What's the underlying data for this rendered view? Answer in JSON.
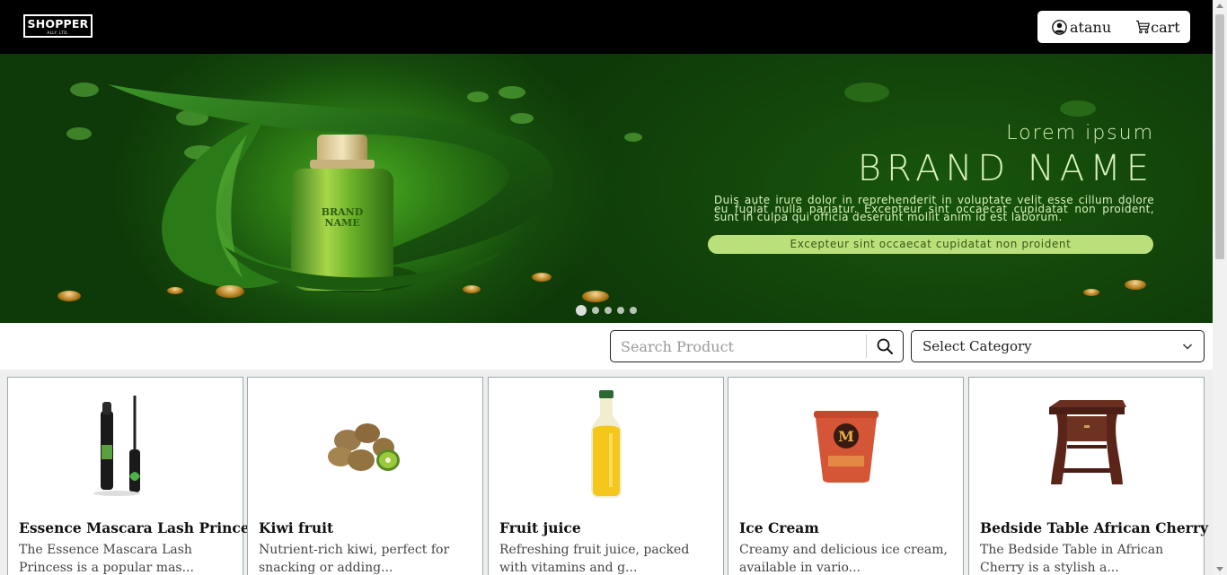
{
  "header": {
    "logo_text": "SHOPPER",
    "logo_subtext": "ALLY. LTD.",
    "user_label": "atanu",
    "cart_label": "cart",
    "user_icon": "user-circle-icon",
    "cart_icon": "cart-icon"
  },
  "hero": {
    "small_heading": "Lorem ipsum",
    "brand_heading": "BRAND NAME",
    "paragraph": "Duis aute irure dolor in reprehenderit in voluptate velit esse cillum dolore eu fugiat nulla pariatur. Excepteur sint occaecat cupidatat non proident, sunt in culpa qui officia deserunt mollit anim id est laborum.",
    "pill_text": "Excepteur sint occaecat cupidatat non proident",
    "product_label_line1": "BRAND",
    "product_label_line2": "NAME",
    "slide_count": 5,
    "active_slide": 1
  },
  "filters": {
    "search_placeholder": "Search Product",
    "search_value": "",
    "search_icon": "search-icon",
    "category_selected": "Select Category",
    "category_icon": "chevron-down-icon"
  },
  "products": [
    {
      "title": "Essence Mascara Lash Princess",
      "desc": "The Essence Mascara Lash Princess is a popular mas..."
    },
    {
      "title": "Kiwi fruit",
      "desc": "Nutrient-rich kiwi, perfect for snacking or adding..."
    },
    {
      "title": "Fruit juice",
      "desc": "Refreshing fruit juice, packed with vitamins and g..."
    },
    {
      "title": "Ice Cream",
      "desc": "Creamy and delicious ice cream, available in vario..."
    },
    {
      "title": "Bedside Table African Cherry",
      "desc": "The Bedside Table in African Cherry is a stylish a..."
    }
  ],
  "colors": {
    "header_bg": "#000000",
    "hero_green": "#2c7a14",
    "hero_text": "#d8f2b8",
    "pill_bg": "#b9e07a"
  }
}
